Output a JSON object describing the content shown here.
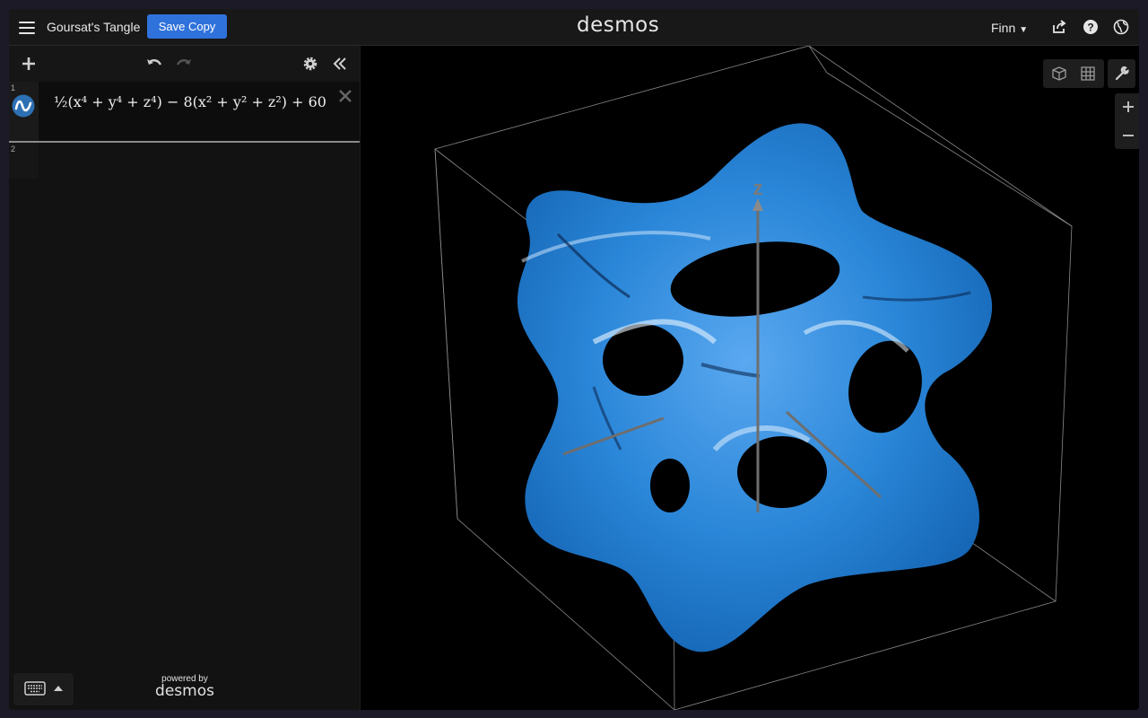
{
  "header": {
    "title": "Goursat's Tangle",
    "save_label": "Save Copy",
    "logo": "desmos",
    "user": "Finn"
  },
  "expressions": [
    {
      "number": "1",
      "latex_display": "½(x⁴ + y⁴ + z⁴) − 8(x² + y² + z²) + 60",
      "color": "#2d70b3",
      "icon": "implicit-surface-icon"
    },
    {
      "number": "2",
      "latex_display": ""
    }
  ],
  "footer": {
    "powered_by": "powered by",
    "logo": "desmos"
  },
  "graph": {
    "axis_label_z": "z",
    "surface_color": "#1e78c8",
    "controls": [
      "3d-view-icon",
      "2d-view-icon",
      "wrench-icon",
      "zoom-in-icon",
      "zoom-out-icon"
    ]
  },
  "colors": {
    "accent": "#2f72dc",
    "background": "#000000"
  }
}
